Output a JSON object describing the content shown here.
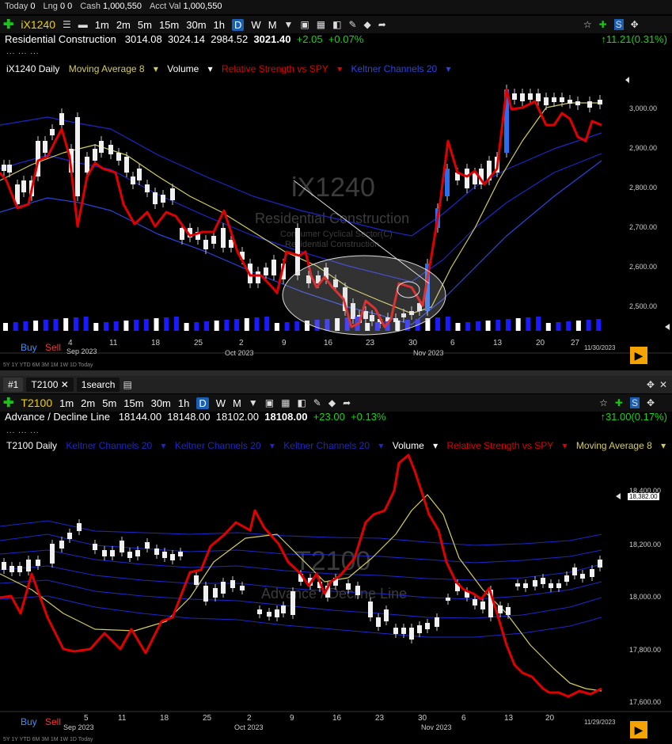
{
  "account": {
    "today_label": "Today",
    "today": "0",
    "lng_label": "Lng",
    "lng": "0 0",
    "cash_label": "Cash",
    "cash": "1,000,550",
    "acct_label": "Acct Val",
    "acct": "1,000,550"
  },
  "chart1": {
    "symbol": "iX1240",
    "timeframes": [
      "1m",
      "2m",
      "5m",
      "15m",
      "30m",
      "1h",
      "D",
      "W",
      "M"
    ],
    "active_tf": "D",
    "name": "Residential Construction",
    "open": "3014.08",
    "high": "3024.14",
    "low": "2984.52",
    "last": "3021.40",
    "chg": "+2.05",
    "pct": "+0.07%",
    "change_right": "11.21(0.31%)",
    "indicators": {
      "label": "iX1240 Daily",
      "ma": "Moving Average 8",
      "vol": "Volume",
      "rs": "Relative Strength vs SPY",
      "kc": "Keltner Channels 20"
    },
    "watermark": {
      "symbol": "iX1240",
      "name": "Residential Construction",
      "sector": "Consumer Cyclical Sector(C)",
      "industry": "Residential Construction"
    },
    "yticks": [
      "3,000.00",
      "2,900.00",
      "2,800.00",
      "2,700.00",
      "2,600.00",
      "2,500.00"
    ],
    "xticks": [
      "4",
      "11",
      "18",
      "25",
      "2",
      "9",
      "16",
      "23",
      "30",
      "6",
      "13",
      "20",
      "27"
    ],
    "months": [
      "Sep 2023",
      "Oct 2023",
      "Nov 2023"
    ],
    "date": "11/30/2023",
    "buy": "Buy",
    "sell": "Sell",
    "ranges": "5Y 1Y YTD 6M 3M 1M 1W 1D Today"
  },
  "chart2": {
    "tab_id": "#1",
    "tab_search": "1search",
    "symbol": "T2100",
    "timeframes": [
      "1m",
      "2m",
      "5m",
      "15m",
      "30m",
      "1h",
      "D",
      "W",
      "M"
    ],
    "active_tf": "D",
    "name": "Advance / Decline Line",
    "open": "18144.00",
    "high": "18148.00",
    "low": "18102.00",
    "last": "18108.00",
    "chg": "+23.00",
    "pct": "+0.13%",
    "change_right": "31.00(0.17%)",
    "indicators": {
      "label": "T2100 Daily",
      "kc1": "Keltner Channels 20",
      "kc2": "Keltner Channels 20",
      "kc3": "Keltner Channels 20",
      "vol": "Volume",
      "rs": "Relative Strength vs SPY",
      "ma": "Moving Average 8"
    },
    "watermark": {
      "symbol": "T2100",
      "name": "Advance / Decline Line"
    },
    "yticks": [
      "18,400.00",
      "18,200.00",
      "18,000.00",
      "17,800.00",
      "17,600.00"
    ],
    "price_box": "18,382.00",
    "xticks": [
      "5",
      "11",
      "18",
      "25",
      "2",
      "9",
      "16",
      "23",
      "30",
      "6",
      "13",
      "20"
    ],
    "months": [
      "Sep 2023",
      "Oct 2023",
      "Nov 2023"
    ],
    "date": "11/29/2023",
    "buy": "Buy",
    "sell": "Sell",
    "ranges": "5Y 1Y YTD 6M 3M 1M 1W 1D Today"
  },
  "colors": {
    "rs": "#e00000",
    "ma": "#d4cc5a",
    "kc": "#1c27c8",
    "kc_outer": "#2a44e0",
    "vol": "#1a1aff",
    "accent": "#f0d000"
  }
}
